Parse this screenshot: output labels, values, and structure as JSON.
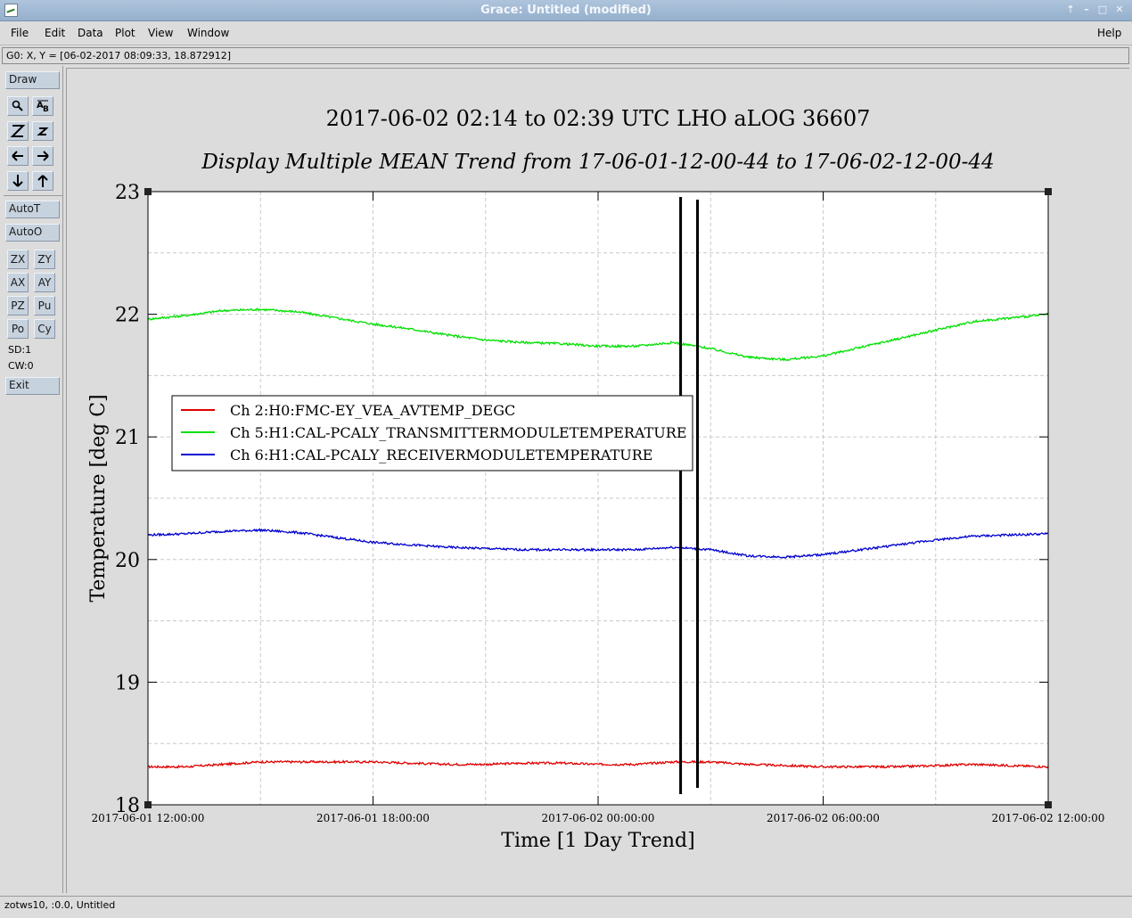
{
  "window": {
    "title": "Grace: Untitled (modified)"
  },
  "menubar": {
    "items": [
      "File",
      "Edit",
      "Data",
      "Plot",
      "View",
      "Window"
    ],
    "help": "Help"
  },
  "locator": {
    "text": "G0: X, Y = [06-02-2017 08:09:33, 18.872912]"
  },
  "toolbar": {
    "draw": "Draw",
    "autot": "AutoT",
    "autoo": "AutoO",
    "zx": "ZX",
    "zy": "ZY",
    "ax": "AX",
    "ay": "AY",
    "pz": "PZ",
    "pu": "Pu",
    "po": "Po",
    "cy": "Cy",
    "sd": "SD:1",
    "cw": "CW:0",
    "exit": "Exit"
  },
  "status": {
    "text": "zotws10, :0.0, Untitled"
  },
  "colors": {
    "ch2": "#e00000",
    "ch5": "#00e000",
    "ch6": "#0000d0"
  },
  "chart_data": {
    "type": "line",
    "title": "2017-06-02 02:14 to 02:39 UTC LHO aLOG 36607",
    "subtitle": "Display Multiple MEAN Trend from 17-06-01-12-00-44 to 17-06-02-12-00-44",
    "xlabel": "Time [1 Day Trend]",
    "ylabel": "Temperature [deg C]",
    "ylim": [
      18,
      23
    ],
    "yticks": [
      "18",
      "19",
      "20",
      "21",
      "22",
      "23"
    ],
    "xticks": [
      "2017-06-01 12:00:00",
      "2017-06-01 18:00:00",
      "2017-06-02 00:00:00",
      "2017-06-02 06:00:00",
      "2017-06-02 12:00:00"
    ],
    "x_hours": [
      0,
      1,
      2,
      3,
      4,
      5,
      6,
      7,
      8,
      9,
      10,
      11,
      12,
      13,
      14,
      15,
      16,
      17,
      18,
      19,
      20,
      21,
      22,
      23,
      24
    ],
    "grid": true,
    "legend_position": "middle-left",
    "markers_hours": [
      14.2,
      14.65
    ],
    "series": [
      {
        "name": "Ch 2:H0:FMC-EY_VEA_AVTEMP_DEGC",
        "color_key": "ch2",
        "values": [
          18.31,
          18.31,
          18.33,
          18.35,
          18.35,
          18.35,
          18.35,
          18.34,
          18.33,
          18.33,
          18.34,
          18.34,
          18.33,
          18.33,
          18.35,
          18.35,
          18.33,
          18.32,
          18.31,
          18.31,
          18.31,
          18.32,
          18.33,
          18.32,
          18.31
        ]
      },
      {
        "name": "Ch 5:H1:CAL-PCALY_TRANSMITTERMODULETEMPERATURE",
        "color_key": "ch5",
        "values": [
          21.96,
          21.99,
          22.03,
          22.04,
          22.02,
          21.97,
          21.92,
          21.88,
          21.83,
          21.79,
          21.77,
          21.76,
          21.74,
          21.74,
          21.77,
          21.72,
          21.65,
          21.63,
          21.66,
          21.73,
          21.8,
          21.87,
          21.94,
          21.97,
          22.0
        ]
      },
      {
        "name": "Ch 6:H1:CAL-PCALY_RECEIVERMODULETEMPERATURE",
        "color_key": "ch6",
        "values": [
          20.2,
          20.21,
          20.23,
          20.24,
          20.22,
          20.18,
          20.14,
          20.12,
          20.1,
          20.09,
          20.08,
          20.08,
          20.08,
          20.08,
          20.1,
          20.08,
          20.03,
          20.02,
          20.04,
          20.08,
          20.12,
          20.16,
          20.19,
          20.2,
          20.21
        ]
      }
    ]
  }
}
